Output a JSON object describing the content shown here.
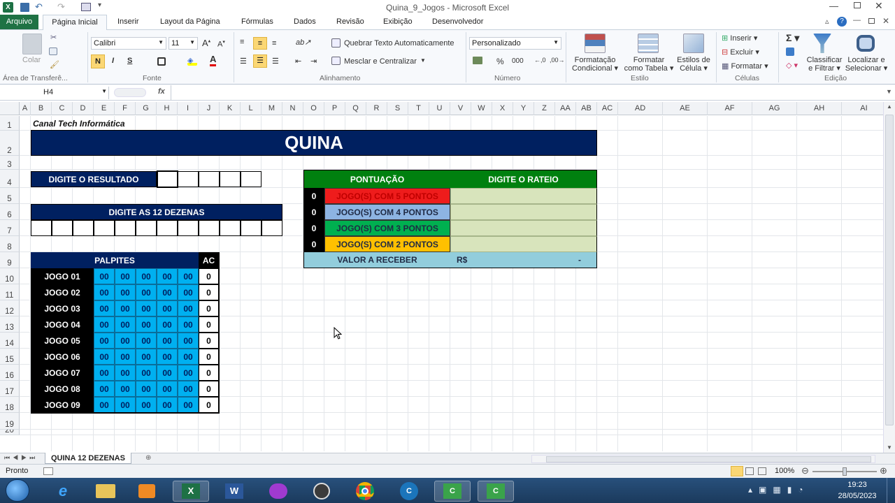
{
  "window": {
    "title": "Quina_9_Jogos  -  Microsoft Excel"
  },
  "tabs": [
    {
      "label": "Arquivo"
    },
    {
      "label": "Página Inicial"
    },
    {
      "label": "Inserir"
    },
    {
      "label": "Layout da Página"
    },
    {
      "label": "Fórmulas"
    },
    {
      "label": "Dados"
    },
    {
      "label": "Revisão"
    },
    {
      "label": "Exibição"
    },
    {
      "label": "Desenvolvedor"
    }
  ],
  "ribbon": {
    "colar": "Colar",
    "font_name": "Calibri",
    "font_size": "11",
    "bold": "N",
    "italic": "I",
    "underline": "S",
    "wrap": "Quebrar Texto Automaticamente",
    "merge": "Mesclar e Centralizar",
    "number_format": "Personalizado",
    "percent": "%",
    "thousands": "000",
    "cond1": "Formatação",
    "cond2": "Condicional",
    "table1": "Formatar",
    "table2": "como Tabela",
    "style1": "Estilos de",
    "style2": "Célula",
    "insert": "Inserir",
    "delete": "Excluir",
    "format": "Formatar",
    "sort1": "Classificar",
    "sort2": "e Filtrar",
    "find1": "Localizar e",
    "find2": "Selecionar",
    "groups": {
      "clip": "Área de Transferê...",
      "font": "Fonte",
      "align": "Alinhamento",
      "number": "Número",
      "style": "Estilo",
      "cells": "Células",
      "edit": "Edição"
    }
  },
  "formula_bar": {
    "name_box": "H4",
    "fx": "fx",
    "value": ""
  },
  "columns": [
    "A",
    "B",
    "C",
    "D",
    "E",
    "F",
    "G",
    "H",
    "I",
    "J",
    "K",
    "L",
    "M",
    "N",
    "O",
    "P",
    "Q",
    "R",
    "S",
    "T",
    "U",
    "V",
    "W",
    "X",
    "Y",
    "Z",
    "AA",
    "AB",
    "AC",
    "AD",
    "AE",
    "AF",
    "AG",
    "AH",
    "AI"
  ],
  "rows": [
    "1",
    "2",
    "3",
    "4",
    "5",
    "6",
    "7",
    "8",
    "9",
    "10",
    "11",
    "12",
    "13",
    "14",
    "15",
    "16",
    "17",
    "18",
    "19",
    "20"
  ],
  "sheet": {
    "channel": "Canal Tech Informática",
    "title": "QUINA",
    "result_label": "DIGITE O RESULTADO",
    "dozens_label": "DIGITE AS 12 DEZENAS",
    "guesses_header": "PALPITES",
    "ac_header": "AC",
    "games": [
      {
        "label": "JOGO 01",
        "nums": [
          "00",
          "00",
          "00",
          "00",
          "00"
        ],
        "ac": "0"
      },
      {
        "label": "JOGO 02",
        "nums": [
          "00",
          "00",
          "00",
          "00",
          "00"
        ],
        "ac": "0"
      },
      {
        "label": "JOGO 03",
        "nums": [
          "00",
          "00",
          "00",
          "00",
          "00"
        ],
        "ac": "0"
      },
      {
        "label": "JOGO 04",
        "nums": [
          "00",
          "00",
          "00",
          "00",
          "00"
        ],
        "ac": "0"
      },
      {
        "label": "JOGO 05",
        "nums": [
          "00",
          "00",
          "00",
          "00",
          "00"
        ],
        "ac": "0"
      },
      {
        "label": "JOGO 06",
        "nums": [
          "00",
          "00",
          "00",
          "00",
          "00"
        ],
        "ac": "0"
      },
      {
        "label": "JOGO 07",
        "nums": [
          "00",
          "00",
          "00",
          "00",
          "00"
        ],
        "ac": "0"
      },
      {
        "label": "JOGO 08",
        "nums": [
          "00",
          "00",
          "00",
          "00",
          "00"
        ],
        "ac": "0"
      },
      {
        "label": "JOGO 09",
        "nums": [
          "00",
          "00",
          "00",
          "00",
          "00"
        ],
        "ac": "0"
      }
    ],
    "score_header": "PONTUAÇÃO",
    "rateio_header": "DIGITE O RATEIO",
    "scores": [
      {
        "count": "0",
        "label": "JOGO(S) COM 5 PONTOS",
        "color": "#ee1c1c",
        "text": "#c00000"
      },
      {
        "count": "0",
        "label": "JOGO(S) COM 4 PONTOS",
        "color": "#8db4e2",
        "text": "#1f2a44"
      },
      {
        "count": "0",
        "label": "JOGO(S) COM 3 PONTOS",
        "color": "#00b050",
        "text": "#1f2a44"
      },
      {
        "count": "0",
        "label": "JOGO(S) COM 2 PONTOS",
        "color": "#ffc000",
        "text": "#1f2a44"
      }
    ],
    "receive_label": "VALOR A RECEBER",
    "currency": "R$",
    "receive_value": "-"
  },
  "sheet_tab": "QUINA 12 DEZENAS",
  "status": {
    "ready": "Pronto",
    "zoom": "100%"
  },
  "clock": {
    "time": "19:23",
    "date": "28/05/2023"
  },
  "colors": {
    "navy": "#002060",
    "green": "#00800f",
    "cyan": "#00b0f0",
    "rateio": "#d8e4bc",
    "receive": "#92cddc",
    "excel_green": "#1e7145"
  }
}
